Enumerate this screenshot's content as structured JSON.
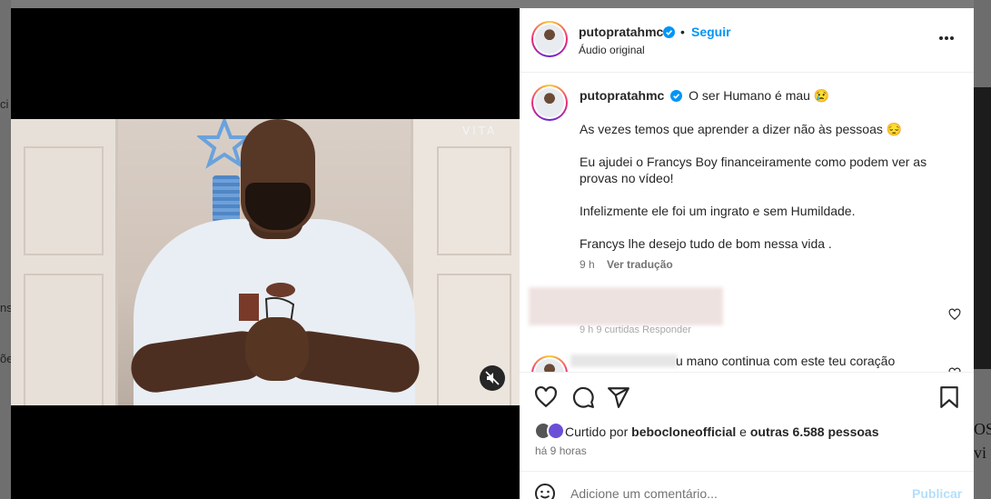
{
  "background": {
    "left_fragments": [
      "ci",
      "ns",
      "õe"
    ],
    "right_fragments": [
      "OS",
      "vi"
    ]
  },
  "media": {
    "watermark": "VITA",
    "mute_icon": "speaker-muted-icon"
  },
  "post_header": {
    "username": "putopratahmc",
    "separator": "•",
    "follow_label": "Seguir",
    "audio_label": "Áudio original",
    "more_icon": "more-options-icon"
  },
  "caption": {
    "username": "putopratahmc",
    "first_line": "O ser Humano é mau 😢",
    "paragraphs": [
      "As vezes temos que aprender a dizer não às pessoas 😔",
      "Eu ajudei o Francys Boy financeiramente como podem ver as provas no vídeo!",
      "Infelizmente ele foi um ingrato e sem Humildade.",
      "Francys lhe desejo tudo de bom nessa vida ."
    ],
    "time": "9 h",
    "translate_label": "Ver tradução"
  },
  "comments": [
    {
      "meta_fragment": "9 h    9 curtidas    Responder"
    },
    {
      "text_fragment": "u mano continua com este teu coração"
    }
  ],
  "actions": {
    "like_icon": "heart-icon",
    "comment_icon": "comment-icon",
    "share_icon": "share-icon",
    "save_icon": "bookmark-icon"
  },
  "likes": {
    "prefix": "Curtido por",
    "user": "bebocloneofficial",
    "middle": "e",
    "others": "outras 6.588 pessoas"
  },
  "time_ago": "há 9 horas",
  "add_comment": {
    "emoji_icon": "emoji-icon",
    "placeholder": "Adicione um comentário...",
    "publish_label": "Publicar"
  },
  "colors": {
    "link_blue": "#0095f6",
    "publish_disabled": "#b2dffc",
    "verified_blue": "#0095f6"
  }
}
